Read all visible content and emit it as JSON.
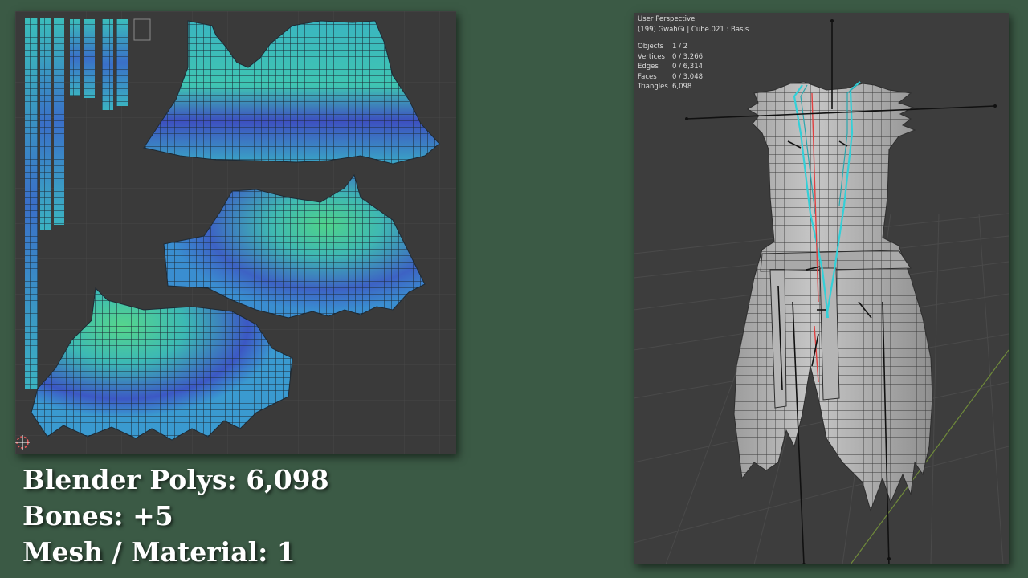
{
  "viewport": {
    "view_name": "User Perspective",
    "object_info": "(199) GwahGi | Cube.021 : Basis",
    "stats": [
      {
        "key": "Objects",
        "value": "1 / 2"
      },
      {
        "key": "Vertices",
        "value": "0 / 3,266"
      },
      {
        "key": "Edges",
        "value": "0 / 6,314"
      },
      {
        "key": "Faces",
        "value": "0 / 3,048"
      },
      {
        "key": "Triangles",
        "value": "6,098"
      }
    ]
  },
  "captions": {
    "polys": "Blender Polys: 6,098",
    "bones": "Bones:  +5",
    "mesh_material": "Mesh / Material: 1"
  },
  "colors": {
    "background": "#3b5a45",
    "panel": "#3a3a3a",
    "uv_teal": "#3fc6b5",
    "uv_blue": "#3a52c2",
    "mesh_gray": "#b9b9b9",
    "seam_cyan": "#33d0d8"
  }
}
